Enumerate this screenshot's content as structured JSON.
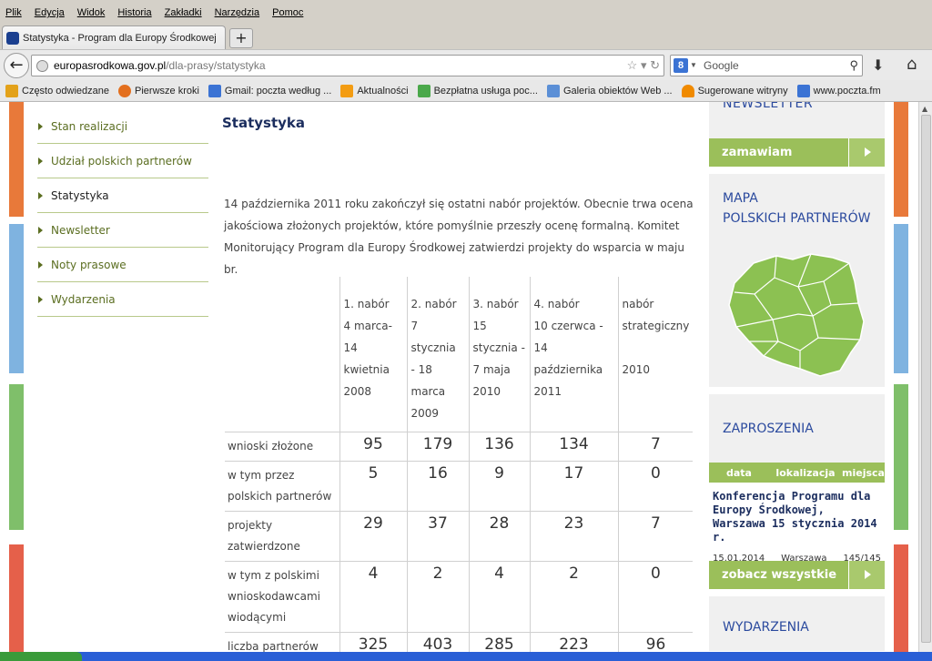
{
  "menu": [
    "Plik",
    "Edycja",
    "Widok",
    "Historia",
    "Zakładki",
    "Narzędzia",
    "Pomoc"
  ],
  "tab": {
    "title": "Statystyka - Program dla Europy Środkowej",
    "new_tab": "+"
  },
  "nav": {
    "url_host": "europasrodkowa.gov.pl",
    "url_path": "/dla-prasy/statystyka",
    "search_placeholder": "Google"
  },
  "bookmarks": [
    {
      "label": "Często odwiedzane",
      "icon": "folder-icon",
      "color": "#e3a21a"
    },
    {
      "label": "Pierwsze kroki",
      "icon": "firefox-icon",
      "color": "#e36f1e"
    },
    {
      "label": "Gmail: poczta według ...",
      "icon": "google-icon",
      "color": "#3b73d4"
    },
    {
      "label": "Aktualności",
      "icon": "rss-icon",
      "color": "#f39c12"
    },
    {
      "label": "Bezpłatna usługa poc...",
      "icon": "windows-icon",
      "color": "#4aa84a"
    },
    {
      "label": "Galeria obiektów Web ...",
      "icon": "gallery-icon",
      "color": "#5b8fd6"
    },
    {
      "label": "Sugerowane witryny",
      "icon": "suggest-icon",
      "color": "#f08a00"
    },
    {
      "label": "www.poczta.fm",
      "icon": "google-icon",
      "color": "#3b73d4"
    }
  ],
  "leftnav": [
    {
      "label": "Stan realizacji",
      "active": false
    },
    {
      "label": "Udział polskich partnerów",
      "active": false
    },
    {
      "label": "Statystyka",
      "active": true
    },
    {
      "label": "Newsletter",
      "active": false
    },
    {
      "label": "Noty prasowe",
      "active": false
    },
    {
      "label": "Wydarzenia",
      "active": false
    }
  ],
  "content": {
    "title": "Statystyka",
    "intro": "14 października 2011 roku zakończył się ostatni nabór projektów. Obecnie trwa ocena jakościowa złożonych projektów, które pomyślnie przeszły ocenę formalną. Komitet Monitorujący Program dla Europy Środkowej zatwierdzi projekty do wsparcia w maju br."
  },
  "stats": {
    "headers": [
      [
        "1. nabór",
        "4 marca-14",
        "kwietnia",
        "2008"
      ],
      [
        "2. nabór",
        "7 stycznia",
        "- 18",
        "marca",
        "2009"
      ],
      [
        "3. nabór",
        "15",
        "stycznia -",
        "7 maja",
        "2010"
      ],
      [
        "4. nabór",
        "10 czerwca - 14",
        "października",
        "2011"
      ],
      [
        "nabór",
        "strategiczny",
        "",
        "2010"
      ]
    ],
    "rows": [
      {
        "label": "wnioski złożone",
        "values": [
          "95",
          "179",
          "136",
          "134",
          "7"
        ]
      },
      {
        "label": "w tym przez polskich partnerów",
        "values": [
          "5",
          "16",
          "9",
          "17",
          "0"
        ]
      },
      {
        "label": "projekty zatwierdzone",
        "values": [
          "29",
          "37",
          "28",
          "23",
          "7"
        ]
      },
      {
        "label": "w tym z polskimi wnioskodawcami wiodącymi",
        "values": [
          "4",
          "2",
          "4",
          "2",
          "0"
        ]
      },
      {
        "label": "liczba partnerów",
        "values": [
          "325",
          "403",
          "285",
          "223",
          "96"
        ]
      }
    ]
  },
  "right": {
    "newsletter": "NEWSLETTER",
    "subscribe": "zamawiam",
    "map_title_1": "MAPA",
    "map_title_2": "POLSKICH PARTNERÓW",
    "invitations": "ZAPROSZENIA",
    "inv_cols": [
      "data",
      "lokalizacja",
      "miejsca"
    ],
    "event_title": "Konferencja Programu dla Europy Środkowej, Warszawa 15 stycznia 2014 r.",
    "event_date": "15.01.2014",
    "event_place": "Warszawa",
    "event_seats": "145/145",
    "see_all": "zobacz wszystkie",
    "events": "WYDARZENIA"
  },
  "colors": {
    "accent_green": "#9bbf5a",
    "title_blue": "#1b2d5e",
    "link_green": "#5b6e21",
    "map_green": "#8cc152"
  }
}
